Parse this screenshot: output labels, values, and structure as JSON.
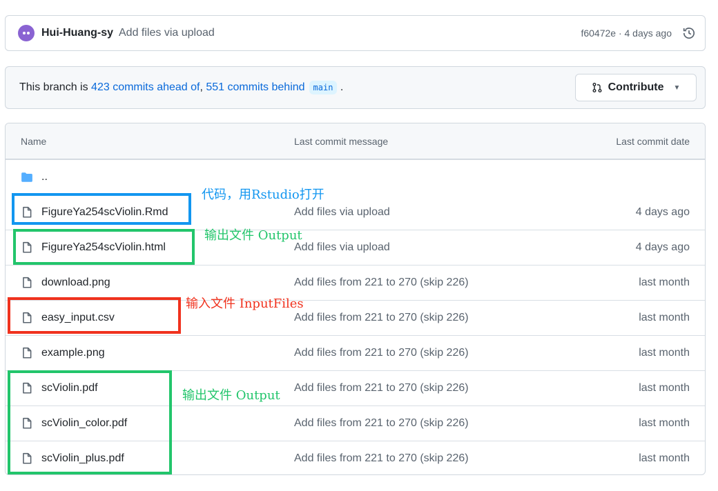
{
  "commit": {
    "author": "Hui-Huang-sy",
    "message": "Add files via upload",
    "meta": "f60472e · 4 days ago"
  },
  "branch": {
    "prefix": "This branch is ",
    "ahead": "423 commits ahead of",
    "sep": ", ",
    "behind": "551 commits behind",
    "branch_name": "main",
    "suffix": " .",
    "contribute_label": "Contribute"
  },
  "table": {
    "headers": {
      "name": "Name",
      "message": "Last commit message",
      "date": "Last commit date"
    },
    "parent": "..",
    "rows": [
      {
        "name": "FigureYa254scViolin.Rmd",
        "message": "Add files via upload",
        "date": "4 days ago"
      },
      {
        "name": "FigureYa254scViolin.html",
        "message": "Add files via upload",
        "date": "4 days ago"
      },
      {
        "name": "download.png",
        "message": "Add files from 221 to 270 (skip 226)",
        "date": "last month"
      },
      {
        "name": "easy_input.csv",
        "message": "Add files from 221 to 270 (skip 226)",
        "date": "last month"
      },
      {
        "name": "example.png",
        "message": "Add files from 221 to 270 (skip 226)",
        "date": "last month"
      },
      {
        "name": "scViolin.pdf",
        "message": "Add files from 221 to 270 (skip 226)",
        "date": "last month"
      },
      {
        "name": "scViolin_color.pdf",
        "message": "Add files from 221 to 270 (skip 226)",
        "date": "last month"
      },
      {
        "name": "scViolin_plus.pdf",
        "message": "Add files from 221 to 270 (skip 226)",
        "date": "last month"
      }
    ]
  },
  "annotations": {
    "code": "代码，用Rstudio打开",
    "output1": "输出文件 Output",
    "input": "输入文件 InputFiles",
    "output2": "输出文件 Output"
  },
  "colors": {
    "blue_box": "#1296f0",
    "green_box": "#22c56b",
    "red_box": "#f0321e",
    "link": "#0969da"
  }
}
